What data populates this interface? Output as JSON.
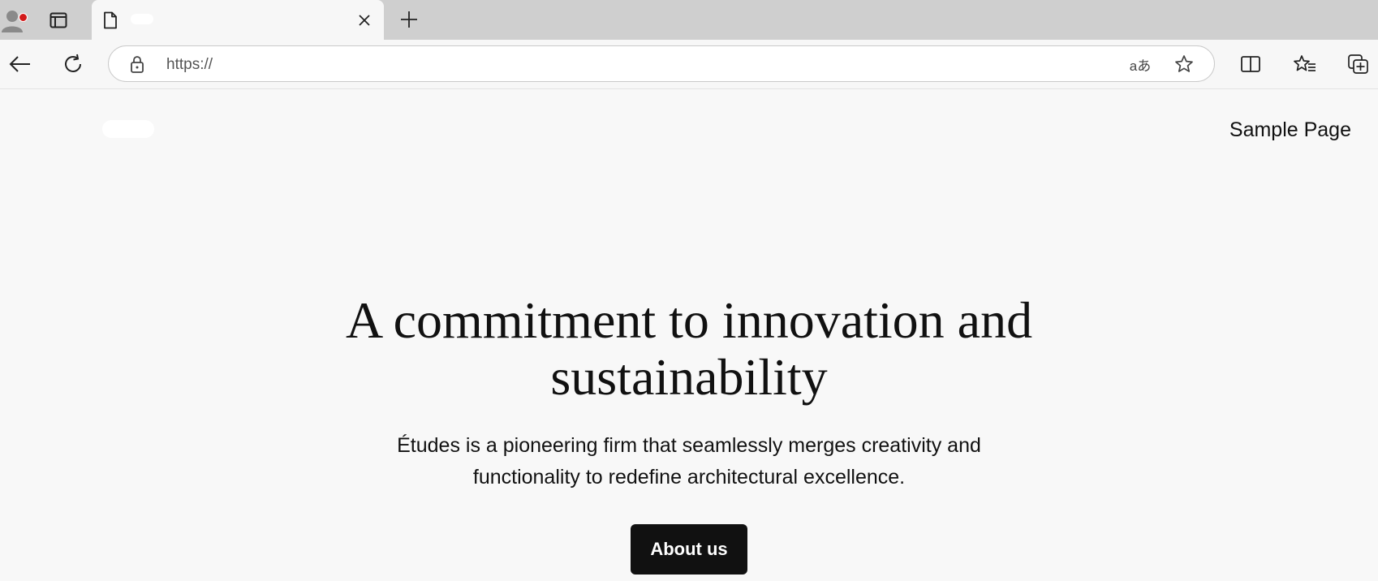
{
  "browser": {
    "tab": {
      "title": "",
      "close_label": "×"
    },
    "new_tab_label": "+",
    "address": {
      "url": "https://"
    },
    "toolbar": {
      "read_aloud_label": "aあ"
    }
  },
  "site": {
    "nav": {
      "link": "Sample Page"
    },
    "hero": {
      "title": "A commitment to innovation and sustainability",
      "text": "Études is a pioneering firm that seamlessly merges creativity and functionality to redefine architectural excellence.",
      "button_label": "About us"
    }
  },
  "colors": {
    "tab_strip": "#cfcfcf",
    "page_background": "#f8f8f8",
    "button_background": "#111111",
    "button_text": "#ffffff",
    "profile_badge": "#d21a1a"
  },
  "icons": [
    "profile-icon",
    "tab-actions-icon",
    "document-icon",
    "close-icon",
    "plus-icon",
    "back-arrow-icon",
    "refresh-icon",
    "lock-icon",
    "read-aloud-icon",
    "star-icon",
    "split-screen-icon",
    "favorites-icon",
    "collections-icon"
  ]
}
